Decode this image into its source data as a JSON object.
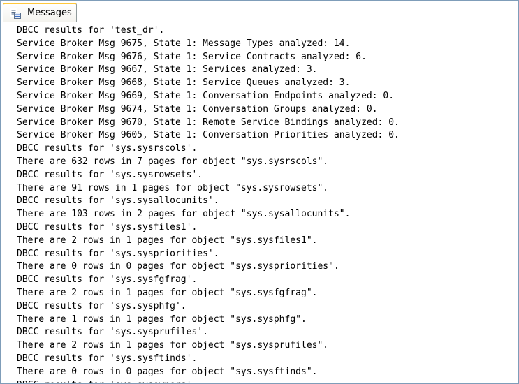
{
  "tab": {
    "label": "Messages",
    "icon": "messages-icon"
  },
  "lines": [
    "DBCC results for 'test_dr'.",
    "Service Broker Msg 9675, State 1: Message Types analyzed: 14.",
    "Service Broker Msg 9676, State 1: Service Contracts analyzed: 6.",
    "Service Broker Msg 9667, State 1: Services analyzed: 3.",
    "Service Broker Msg 9668, State 1: Service Queues analyzed: 3.",
    "Service Broker Msg 9669, State 1: Conversation Endpoints analyzed: 0.",
    "Service Broker Msg 9674, State 1: Conversation Groups analyzed: 0.",
    "Service Broker Msg 9670, State 1: Remote Service Bindings analyzed: 0.",
    "Service Broker Msg 9605, State 1: Conversation Priorities analyzed: 0.",
    "DBCC results for 'sys.sysrscols'.",
    "There are 632 rows in 7 pages for object \"sys.sysrscols\".",
    "DBCC results for 'sys.sysrowsets'.",
    "There are 91 rows in 1 pages for object \"sys.sysrowsets\".",
    "DBCC results for 'sys.sysallocunits'.",
    "There are 103 rows in 2 pages for object \"sys.sysallocunits\".",
    "DBCC results for 'sys.sysfiles1'.",
    "There are 2 rows in 1 pages for object \"sys.sysfiles1\".",
    "DBCC results for 'sys.syspriorities'.",
    "There are 0 rows in 0 pages for object \"sys.syspriorities\".",
    "DBCC results for 'sys.sysfgfrag'.",
    "There are 2 rows in 1 pages for object \"sys.sysfgfrag\".",
    "DBCC results for 'sys.sysphfg'.",
    "There are 1 rows in 1 pages for object \"sys.sysphfg\".",
    "DBCC results for 'sys.sysprufiles'.",
    "There are 2 rows in 1 pages for object \"sys.sysprufiles\".",
    "DBCC results for 'sys.sysftinds'.",
    "There are 0 rows in 0 pages for object \"sys.sysftinds\".",
    "DBCC results for 'sys.sysowners'."
  ]
}
